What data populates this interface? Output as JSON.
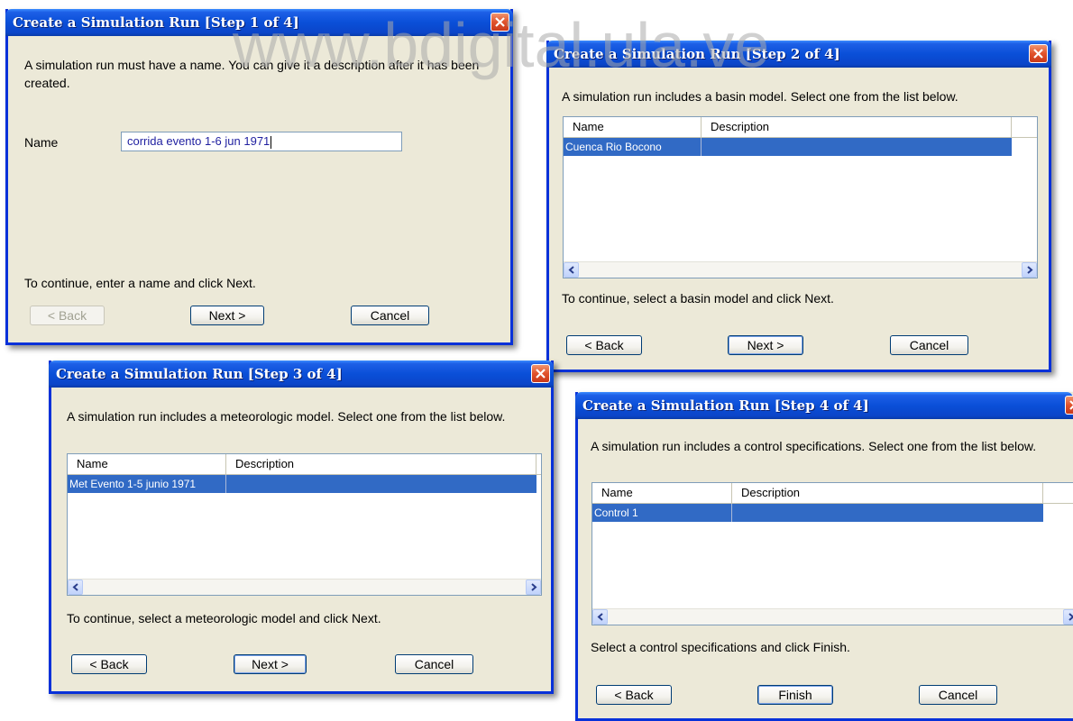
{
  "watermark": "www.bdigital.ula.ve",
  "dialogs": [
    {
      "title": "Create a Simulation Run [Step 1 of 4]",
      "intro": "A simulation run must have a name. You can give it a description after it has been created.",
      "name_label": "Name",
      "name_value": "corrida evento 1-6 jun 1971",
      "instruction": "To continue, enter a name and click Next.",
      "back": "< Back",
      "next": "Next >",
      "cancel": "Cancel"
    },
    {
      "title": "Create a Simulation Run [Step 2 of 4]",
      "intro": "A simulation run includes a basin model. Select one from the list below.",
      "col_name": "Name",
      "col_desc": "Description",
      "row_name": "Cuenca Rio Bocono",
      "row_desc": "",
      "instruction": "To continue, select a basin model and click Next.",
      "back": "< Back",
      "next": "Next >",
      "cancel": "Cancel"
    },
    {
      "title": "Create a Simulation Run [Step 3 of 4]",
      "intro": "A simulation run includes a meteorologic model. Select one from the list below.",
      "col_name": "Name",
      "col_desc": "Description",
      "row_name": "Met Evento 1-5 junio 1971",
      "row_desc": "",
      "instruction": "To continue, select a meteorologic model and click Next.",
      "back": "< Back",
      "next": "Next >",
      "cancel": "Cancel"
    },
    {
      "title": "Create a Simulation Run [Step 4 of 4]",
      "intro": "A simulation run includes a control specifications. Select one from the list below.",
      "col_name": "Name",
      "col_desc": "Description",
      "row_name": "Control 1",
      "row_desc": "",
      "instruction": "Select a control specifications and click Finish.",
      "back": "< Back",
      "finish": "Finish",
      "cancel": "Cancel"
    }
  ],
  "colors": {
    "titlebar": "#0a4fd8",
    "dialog_bg": "#ece9d8",
    "selection": "#316ac5",
    "close": "#e0522c"
  }
}
